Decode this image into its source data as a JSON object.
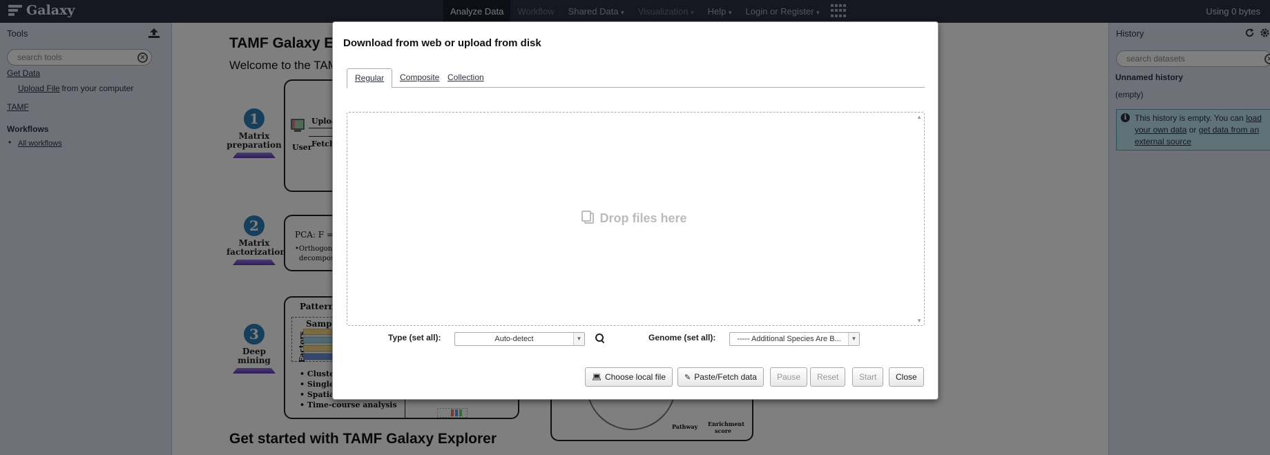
{
  "masthead": {
    "brand": "Galaxy",
    "nav": [
      {
        "label": "Analyze Data",
        "state": "active",
        "has_caret": false
      },
      {
        "label": "Workflow",
        "state": "disabled",
        "has_caret": false
      },
      {
        "label": "Shared Data",
        "state": "normal",
        "has_caret": true
      },
      {
        "label": "Visualization",
        "state": "disabled",
        "has_caret": true
      },
      {
        "label": "Help",
        "state": "normal",
        "has_caret": true
      },
      {
        "label": "Login or Register",
        "state": "normal",
        "has_caret": true
      }
    ],
    "quota": "Using 0 bytes"
  },
  "tools_panel": {
    "title": "Tools",
    "search_placeholder": "search tools",
    "sections": {
      "get_data": "Get Data",
      "upload_link": "Upload File",
      "upload_suffix": " from your computer",
      "tamf": "TAMF",
      "workflows": "Workflows",
      "all_workflows": "All workflows"
    }
  },
  "center": {
    "title": "TAMF Galaxy E",
    "welcome": "Welcome to the TAM",
    "get_started": "Get started with TAMF Galaxy Explorer",
    "steps": [
      {
        "num": "1",
        "line1": "Matrix",
        "line2": "preparation"
      },
      {
        "num": "2",
        "line1": "Matrix",
        "line2": "factorization"
      },
      {
        "num": "3",
        "line1": "Deep",
        "line2": "mining"
      }
    ],
    "box1": {
      "user": "User",
      "upload": "Uploa",
      "fetch": "Fetch"
    },
    "box2": {
      "pca": "PCA: F =",
      "orth": "•Orthogona",
      "decomp": "decomposi"
    },
    "box3": {
      "pattern": "Pattern i",
      "samples": "Sample",
      "factors": "Factors",
      "b1": "• Cluster",
      "b2": "• Single-c",
      "b3": "• Spatial",
      "b4": "• Time-course analysis"
    },
    "box4": {
      "pathway": "Pathway",
      "enrichment": "Enrichment",
      "score": "score"
    }
  },
  "history_panel": {
    "title": "History",
    "search_placeholder": "search datasets",
    "name": "Unnamed history",
    "size": "(empty)",
    "info": {
      "prefix": "This history is empty. You can ",
      "link1": "load your own data",
      "middle": " or ",
      "link2": "get data from an external source"
    }
  },
  "modal": {
    "title": "Download from web or upload from disk",
    "tabs": [
      "Regular",
      "Composite",
      "Collection"
    ],
    "active_tab": "Regular",
    "dropzone_text": "Drop files here",
    "type_label": "Type (set all):",
    "type_value": "Auto-detect",
    "genome_label": "Genome (set all):",
    "genome_value": "----- Additional Species Are B...",
    "buttons": {
      "choose_local": "Choose local file",
      "paste_fetch": "Paste/Fetch data",
      "pause": "Pause",
      "reset": "Reset",
      "start": "Start",
      "close": "Close"
    }
  },
  "colors": {
    "masthead_bg": "#2c3143",
    "panel_bg": "#dfe3f0",
    "step_badge": "#2d7fb8",
    "info_box_bg": "#bde4ee"
  },
  "icons": [
    "galaxy-logo-icon",
    "apps-grid-icon",
    "upload-icon",
    "clear-search-icon",
    "refresh-icon",
    "gear-icon",
    "info-icon",
    "files-icon",
    "search-icon",
    "laptop-icon",
    "edit-icon"
  ]
}
